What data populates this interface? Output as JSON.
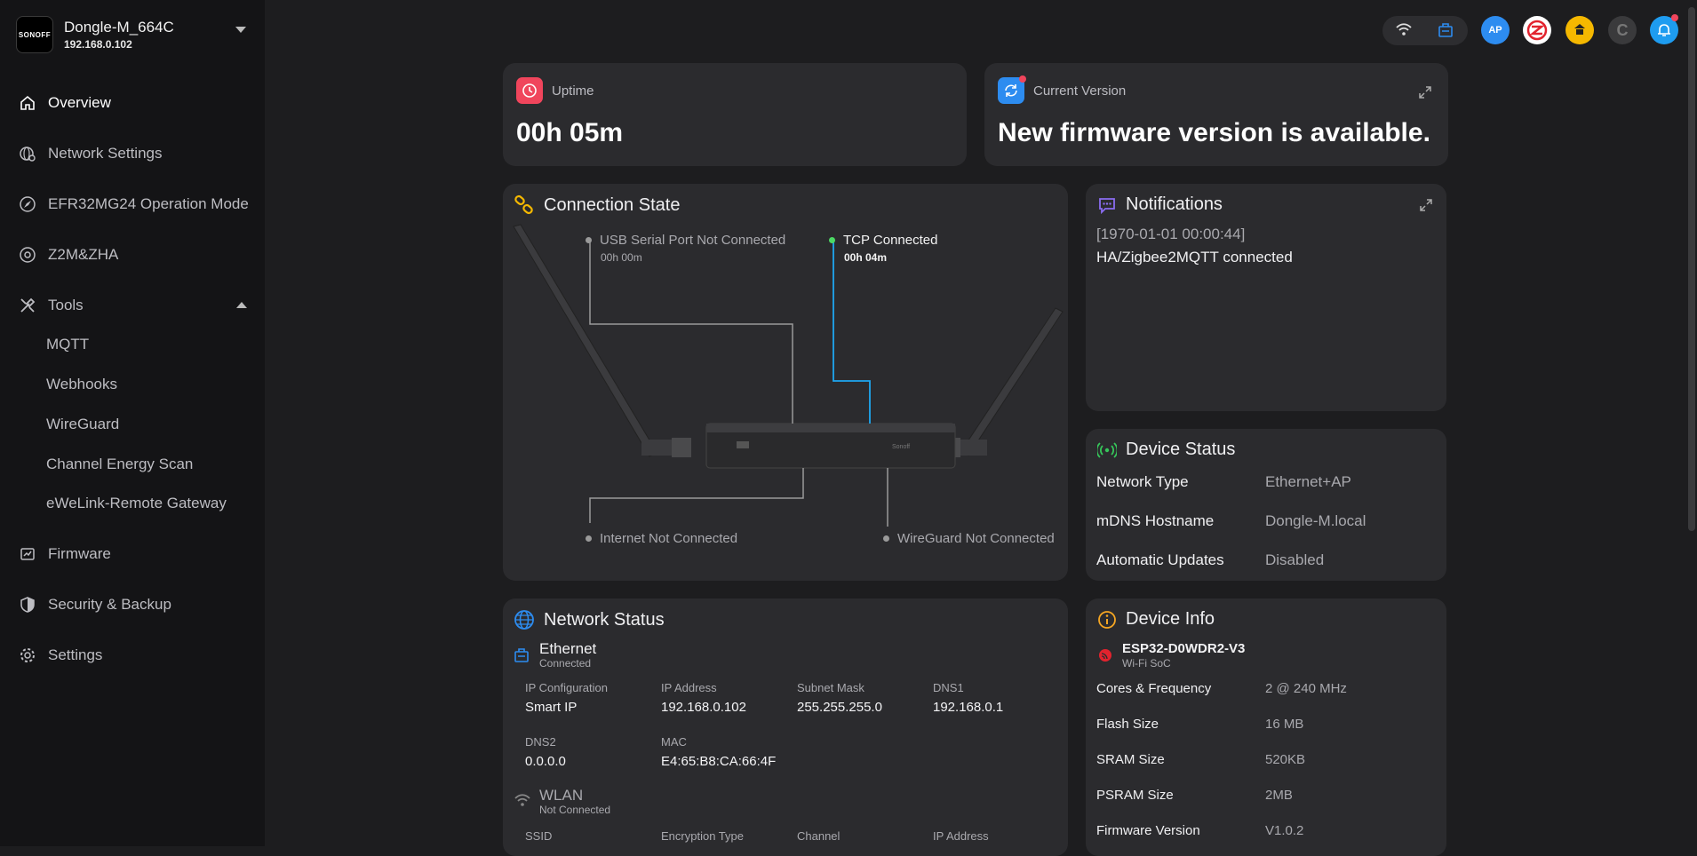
{
  "device": {
    "name": "Dongle-M_664C",
    "ip": "192.168.0.102",
    "logo_text": "SONOFF"
  },
  "sidebar": {
    "items": [
      {
        "label": "Overview",
        "icon": "home-icon"
      },
      {
        "label": "Network Settings",
        "icon": "globe-gear-icon"
      },
      {
        "label": "EFR32MG24 Operation Mode",
        "icon": "compass-icon"
      },
      {
        "label": "Z2M&ZHA",
        "icon": "radar-icon"
      },
      {
        "label": "Tools",
        "icon": "tools-icon"
      },
      {
        "label": "Firmware",
        "icon": "firmware-icon"
      },
      {
        "label": "Security & Backup",
        "icon": "shield-icon"
      },
      {
        "label": "Settings",
        "icon": "gear-icon"
      }
    ],
    "tools_sub": [
      "MQTT",
      "Webhooks",
      "WireGuard",
      "Channel Energy Scan",
      "eWeLink-Remote Gateway"
    ]
  },
  "topbar": {
    "ap_label": "AP",
    "icons": [
      "wifi-icon",
      "ethernet-icon",
      "ap-icon",
      "zigbee-icon",
      "matter-bridge-icon",
      "c-icon",
      "bell-icon"
    ]
  },
  "uptime": {
    "label": "Uptime",
    "value": "00h 05m"
  },
  "version": {
    "label": "Current Version",
    "value": "New firmware version is available."
  },
  "connection": {
    "title": "Connection State",
    "usb": {
      "label": "USB Serial Port Not Connected",
      "time": "00h 00m"
    },
    "tcp": {
      "label": "TCP Connected",
      "time": "00h 04m"
    },
    "internet": {
      "label": "Internet Not Connected"
    },
    "wireguard": {
      "label": "WireGuard Not Connected"
    },
    "device_brand": "Sonoff"
  },
  "notifications": {
    "title": "Notifications",
    "timestamp": "[1970-01-01 00:00:44]",
    "message": "HA/Zigbee2MQTT connected"
  },
  "device_status": {
    "title": "Device Status",
    "rows": [
      {
        "label": "Network Type",
        "value": "Ethernet+AP"
      },
      {
        "label": "mDNS Hostname",
        "value": "Dongle-M.local"
      },
      {
        "label": "Automatic Updates",
        "value": "Disabled"
      }
    ]
  },
  "network_status": {
    "title": "Network Status",
    "ethernet": {
      "name": "Ethernet",
      "state": "Connected",
      "fields": [
        {
          "label": "IP Configuration",
          "value": "Smart IP"
        },
        {
          "label": "IP Address",
          "value": "192.168.0.102"
        },
        {
          "label": "Subnet Mask",
          "value": "255.255.255.0"
        },
        {
          "label": "DNS1",
          "value": "192.168.0.1"
        },
        {
          "label": "DNS2",
          "value": "0.0.0.0"
        },
        {
          "label": "MAC",
          "value": "E4:65:B8:CA:66:4F"
        }
      ]
    },
    "wlan": {
      "name": "WLAN",
      "state": "Not Connected",
      "fields": [
        "SSID",
        "Encryption Type",
        "Channel",
        "IP Address"
      ]
    }
  },
  "device_info": {
    "title": "Device Info",
    "chip": "ESP32-D0WDR2-V3",
    "chip_type": "Wi-Fi SoC",
    "rows": [
      {
        "label": "Cores & Frequency",
        "value": "2 @ 240 MHz"
      },
      {
        "label": "Flash Size",
        "value": "16 MB"
      },
      {
        "label": "SRAM Size",
        "value": "520KB"
      },
      {
        "label": "PSRAM Size",
        "value": "2MB"
      },
      {
        "label": "Firmware Version",
        "value": "V1.0.2"
      }
    ]
  },
  "colors": {
    "accent_blue": "#2d8cf0",
    "uptime_red": "#f0455c",
    "tcp_green": "#4cd964",
    "tcp_line": "#1ea7f0"
  }
}
